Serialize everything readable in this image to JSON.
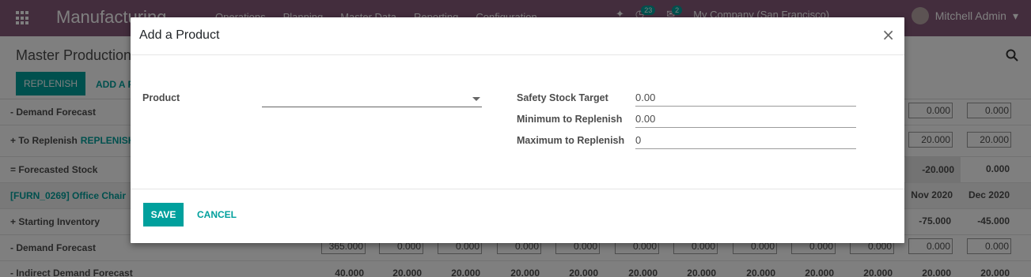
{
  "navbar": {
    "app_name": "Manufacturing",
    "menu": [
      "Operations",
      "Planning",
      "Master Data",
      "Reporting",
      "Configuration"
    ],
    "activity_badge": "23",
    "message_badge": "2",
    "company": "My Company (San Francisco)",
    "user_name": "Mitchell Admin"
  },
  "control": {
    "breadcrumb": "Master Production",
    "replenish_label": "REPLENISH",
    "add_label": "ADD A P"
  },
  "grid": {
    "rows": [
      {
        "label": "- Demand Forecast",
        "values": [
          "0.000",
          "0.000"
        ]
      },
      {
        "label": "+ To Replenish",
        "link": "REPLENISH",
        "values": [
          "20.000",
          "20.000"
        ]
      },
      {
        "label": "= Forecasted Stock",
        "values": [
          "-20.000",
          "0.000"
        ]
      },
      {
        "label": "[FURN_0269] Office Chair",
        "values": [
          "Nov 2020",
          "Dec 2020"
        ]
      },
      {
        "label": "+ Starting Inventory",
        "values": [
          "-75.000",
          "-45.000"
        ]
      },
      {
        "label": "- Demand Forecast",
        "values": [
          "365.000",
          "0.000",
          "0.000",
          "0.000",
          "0.000",
          "0.000",
          "0.000",
          "0.000",
          "0.000",
          "0.000",
          "0.000",
          "0.000"
        ]
      },
      {
        "label": "- Indirect Demand Forecast",
        "values": [
          "40.000",
          "20.000",
          "20.000",
          "20.000",
          "20.000",
          "20.000",
          "20.000",
          "20.000",
          "20.000",
          "20.000",
          "20.000",
          "20.000"
        ]
      }
    ]
  },
  "dialog": {
    "title": "Add a Product",
    "close_symbol": "×",
    "product_label": "Product",
    "product_value": "",
    "safety_stock_label": "Safety Stock Target",
    "safety_stock_value": "0.00",
    "min_label": "Minimum to Replenish",
    "min_value": "0.00",
    "max_label": "Maximum to Replenish",
    "max_value": "0",
    "save_label": "SAVE",
    "cancel_label": "CANCEL"
  },
  "colors": {
    "brand": "#875a7b",
    "accent": "#00a09d"
  }
}
